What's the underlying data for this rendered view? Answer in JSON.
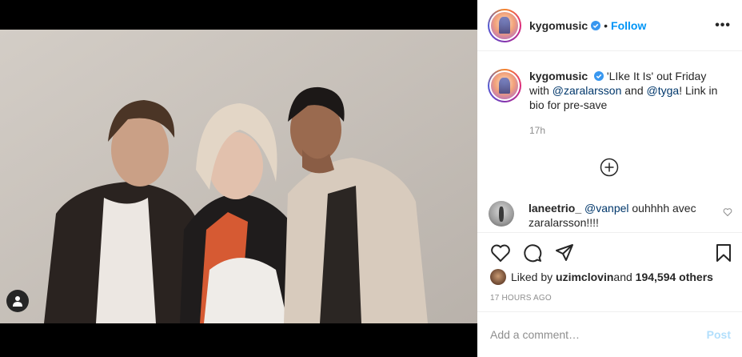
{
  "post": {
    "username": "kygomusic",
    "follow_label": "Follow",
    "more_label": "•••",
    "caption": {
      "username": "kygomusic",
      "text_1": "'LIke It Is' out Friday with ",
      "mention_1": "@zaralarsson",
      "text_2": " and ",
      "mention_2": "@tyga",
      "text_3": "! Link in bio for pre-save",
      "time": "17h"
    },
    "comment": {
      "username": "laneetrio_",
      "mention": "@vanpel",
      "text": " ouhhhh avec zaralarsson!!!!"
    },
    "likes": {
      "prefix": "Liked by ",
      "user": "uzimclovin",
      "middle": " and ",
      "count": "194,594 others"
    },
    "posted_ago": "17 HOURS AGO",
    "add_comment": {
      "placeholder": "Add a comment…",
      "post_label": "Post"
    }
  },
  "colors": {
    "link": "#0095f6",
    "mention": "#00376b",
    "muted": "#8e8e8e",
    "post_disabled": "#b2dffc"
  },
  "icons": [
    "verified-icon",
    "more-options-icon",
    "load-more-comments-icon",
    "heart-icon",
    "comment-icon",
    "share-icon",
    "save-icon",
    "user-tag-icon"
  ]
}
